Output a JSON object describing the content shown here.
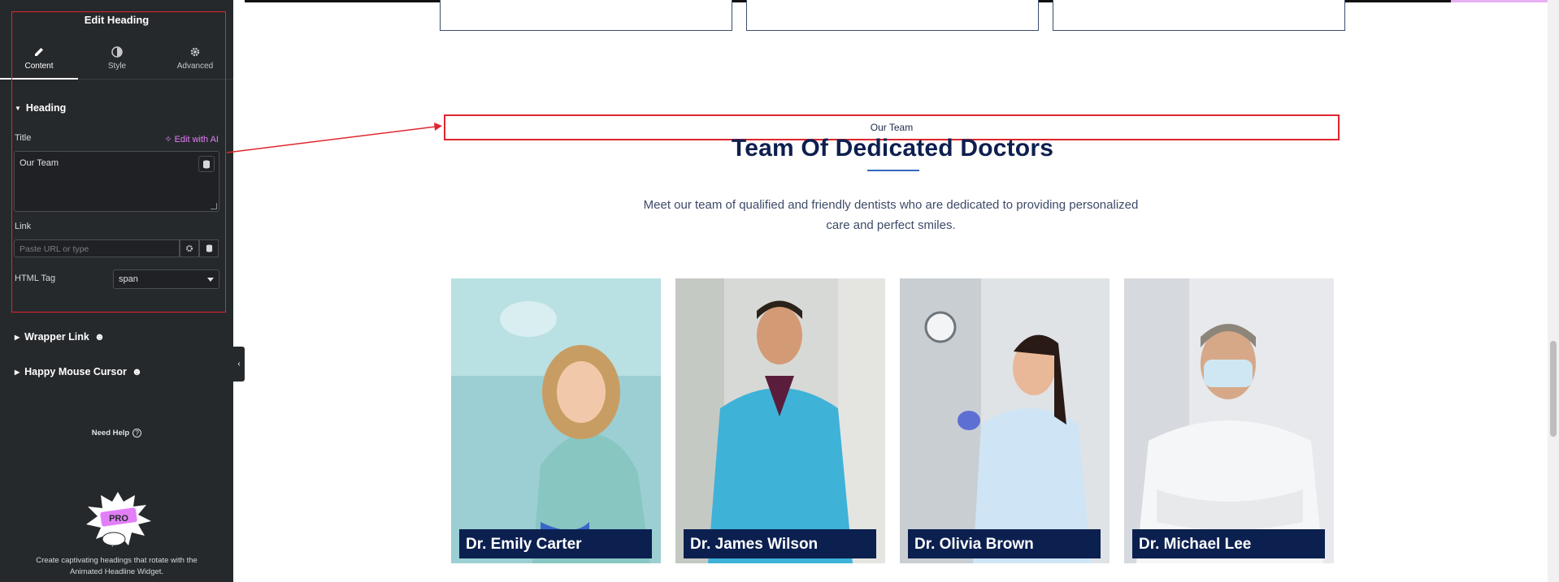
{
  "sidebar": {
    "title": "Edit Heading",
    "tabs": [
      {
        "label": "Content",
        "icon": "pencil-icon"
      },
      {
        "label": "Style",
        "icon": "half-circle-icon"
      },
      {
        "label": "Advanced",
        "icon": "gear-icon"
      }
    ],
    "section_heading": "Heading",
    "title_label": "Title",
    "ai_label": "Edit with AI",
    "title_value": "Our Team",
    "link_label": "Link",
    "link_placeholder": "Paste URL or type",
    "html_tag_label": "HTML Tag",
    "html_tag_value": "span",
    "section_wrapper_link": "Wrapper Link",
    "section_mouse_cursor": "Happy Mouse Cursor",
    "need_help": "Need Help",
    "promo_badge": "PRO",
    "promo_text": "Create captivating headings that rotate with the Animated Headline Widget."
  },
  "page": {
    "subheading": "Our Team",
    "heading": "Team Of Dedicated Doctors",
    "description": "Meet our team of qualified and friendly dentists who are dedicated to providing personalized care and perfect smiles.",
    "doctors": [
      {
        "name": "Dr. Emily Carter"
      },
      {
        "name": "Dr. James Wilson"
      },
      {
        "name": "Dr. Olivia Brown"
      },
      {
        "name": "Dr. Michael Lee"
      }
    ]
  },
  "colors": {
    "sidebar_bg": "#26292c",
    "accent_ai": "#e27ff8",
    "annotation_red": "#e0262f",
    "heading_navy": "#0e1f4f",
    "name_bar": "#0c2050"
  }
}
